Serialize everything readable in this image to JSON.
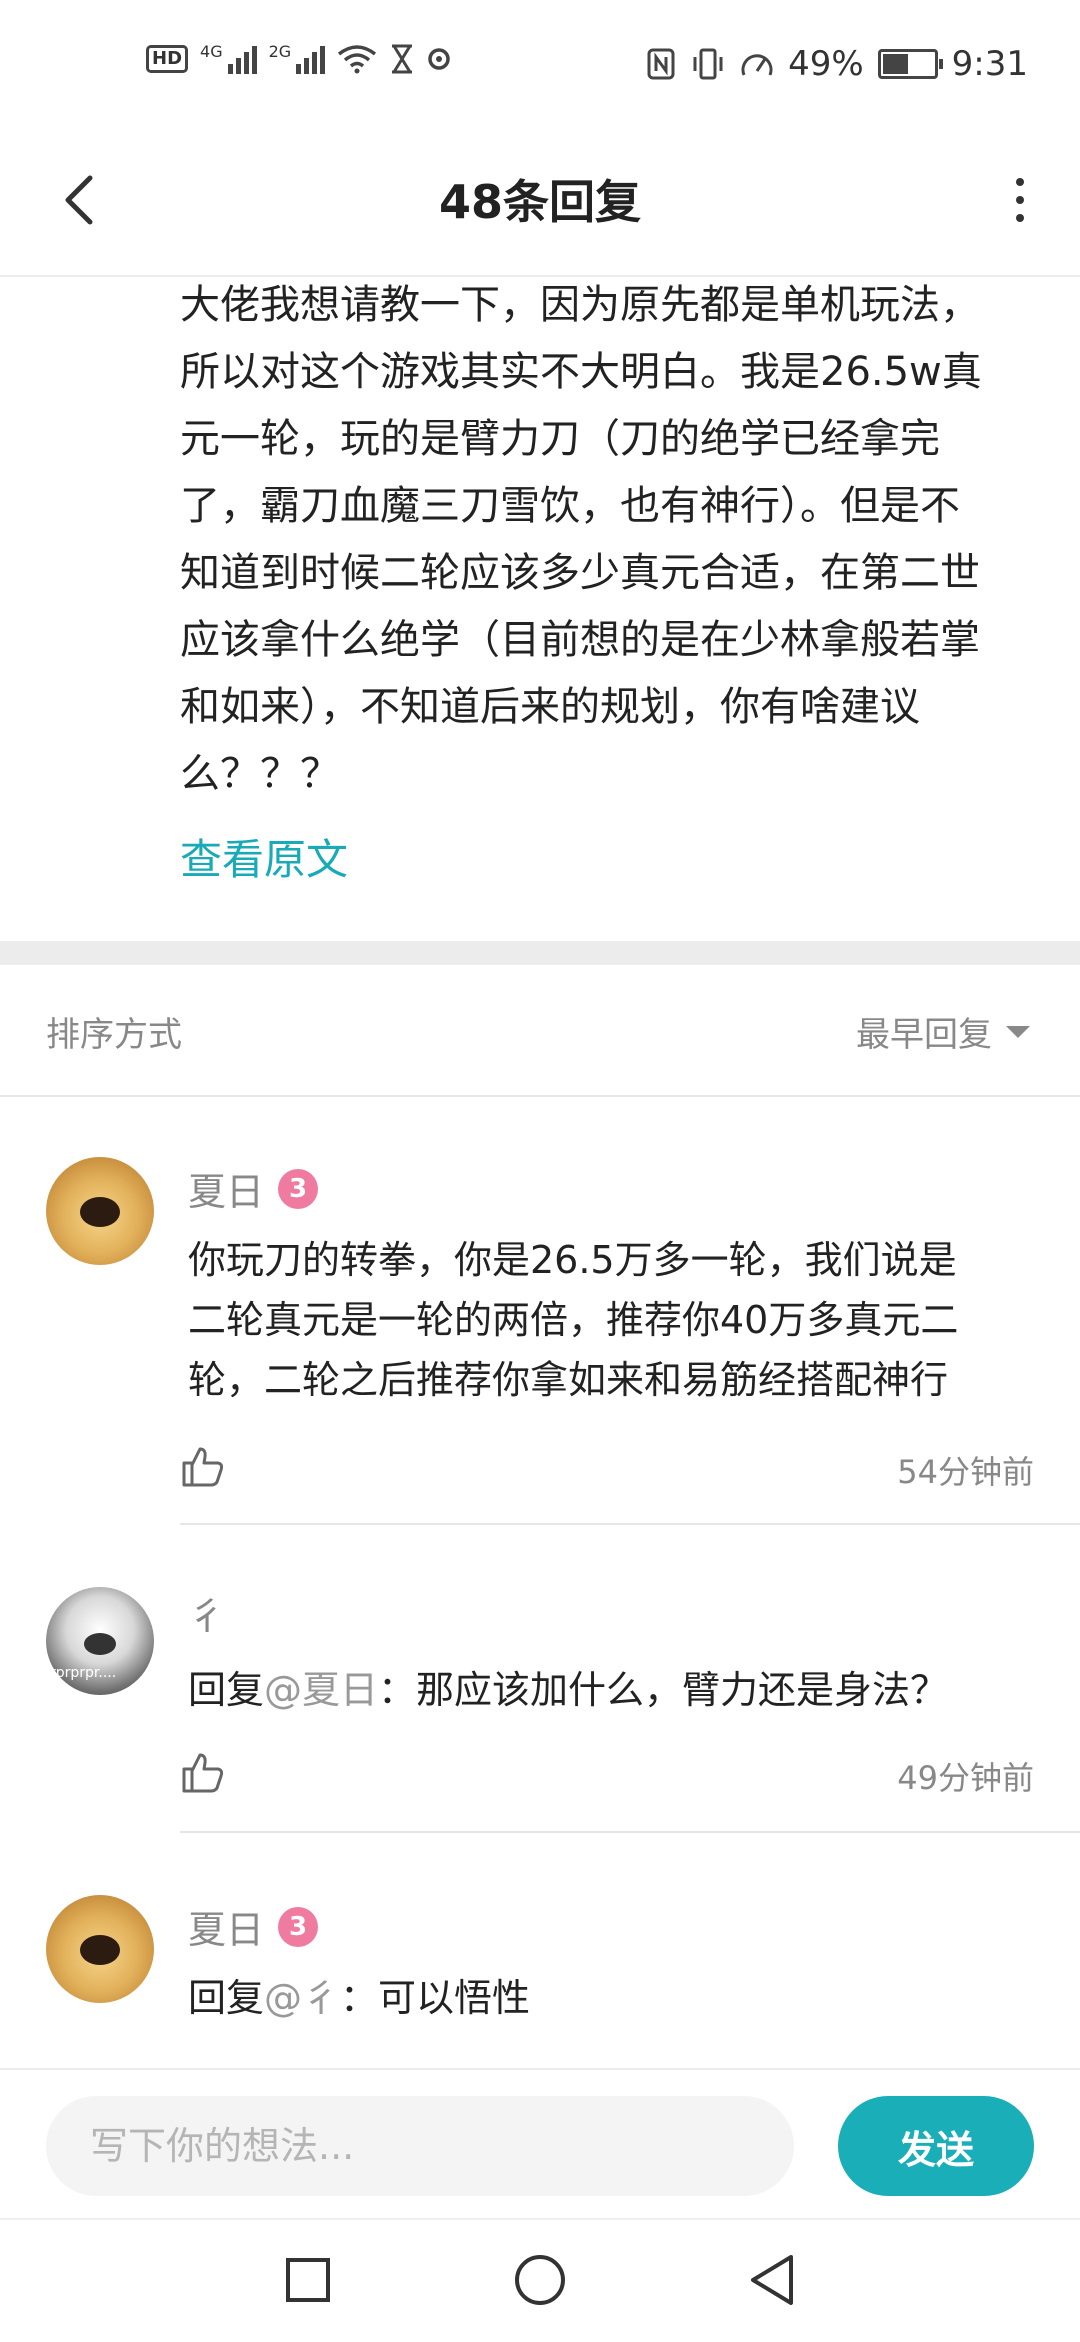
{
  "status_bar": {
    "left_items": [
      "HD",
      "4G",
      "2G"
    ],
    "battery_percent": "49%",
    "battery_level": 0.49,
    "time": "9:31"
  },
  "header": {
    "title": "48条回复",
    "back_icon": "chevron-left-icon",
    "more_icon": "more-vertical-icon"
  },
  "post": {
    "lines": [
      "大佬我想请教一下，因为原先都是单机玩法，",
      "所以对这个游戏其实不大明白。我是26.5w真",
      "元一轮，玩的是臂力刀（刀的绝学已经拿完",
      "了，霸刀血魔三刀雪饮，也有神行）。但是不",
      "知道到时候二轮应该多少真元合适，在第二世",
      "应该拿什么绝学（目前想的是在少林拿般若掌",
      "和如来），不知道后来的规划，你有啥建议",
      "么？？？"
    ],
    "view_original": "查看原文"
  },
  "sort": {
    "label": "排序方式",
    "value": "最早回复"
  },
  "comments": [
    {
      "username": "夏日",
      "badge": "3",
      "lines": [
        "你玩刀的转拳，你是26.5万多一轮，我们说是",
        "二轮真元是一轮的两倍，推荐你40万多真元二",
        "轮，二轮之后推荐你拿如来和易筋经搭配神行"
      ],
      "time": "54分钟前"
    },
    {
      "username": "彳",
      "avatar_caption": "rprprpr....",
      "reply_prefix": "回复",
      "mention": "@夏日",
      "text": "：那应该加什么，臂力还是身法？",
      "time": "49分钟前"
    },
    {
      "username": "夏日",
      "badge": "3",
      "reply_prefix": "回复",
      "mention": "@彳",
      "text": "：可以悟性"
    }
  ],
  "input": {
    "placeholder": "写下你的想法...",
    "send_label": "发送"
  },
  "colors": {
    "accent": "#1aaeb9",
    "link": "#19aab8",
    "badge": "#f07ba0"
  }
}
